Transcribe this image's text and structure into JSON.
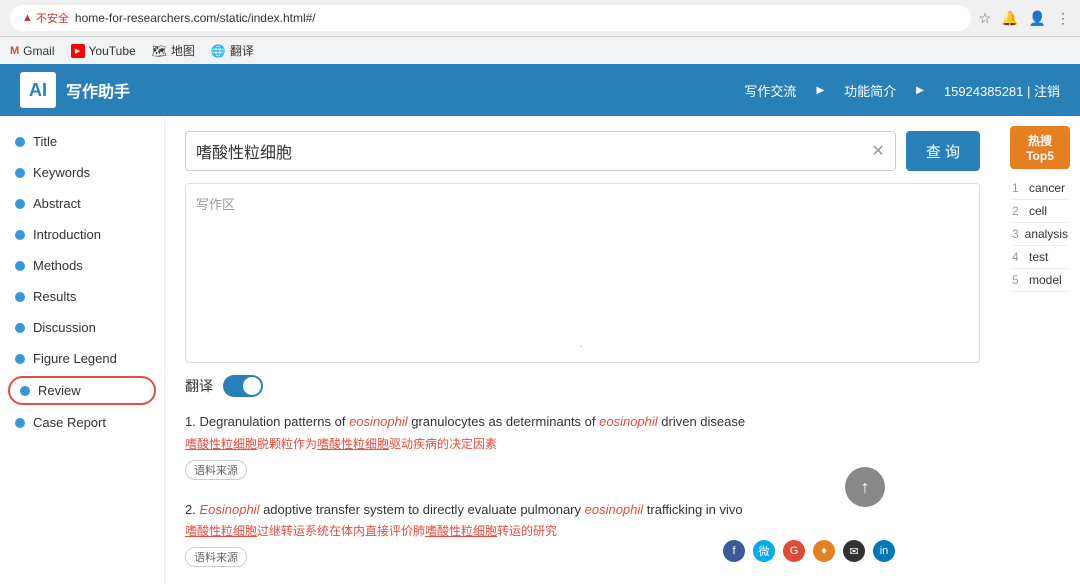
{
  "browser": {
    "warning_text": "不安全",
    "url": "home-for-researchers.com/static/index.html#/",
    "bookmarks": [
      {
        "label": "Gmail",
        "type": "gmail"
      },
      {
        "label": "YouTube",
        "type": "youtube"
      },
      {
        "label": "地图",
        "type": "maps"
      },
      {
        "label": "翻译",
        "type": "translate"
      }
    ]
  },
  "header": {
    "logo_text": "AI",
    "app_name": "写作助手",
    "nav_items": [
      "写作交流",
      "功能简介",
      "15924385281 | 注销"
    ]
  },
  "sidebar": {
    "items": [
      {
        "label": "Title"
      },
      {
        "label": "Keywords"
      },
      {
        "label": "Abstract"
      },
      {
        "label": "Introduction"
      },
      {
        "label": "Methods"
      },
      {
        "label": "Results"
      },
      {
        "label": "Discussion"
      },
      {
        "label": "Figure Legend"
      },
      {
        "label": "Review"
      },
      {
        "label": "Case Report"
      }
    ]
  },
  "main": {
    "search_value": "嗜酸性粒细胞",
    "search_placeholder": "",
    "search_btn_label": "查 询",
    "writing_placeholder": "写作区",
    "translate_label": "翻译",
    "results": [
      {
        "number": "1.",
        "title_before": "Degranulation patterns of ",
        "title_italic1": "eosinophil",
        "title_middle": " granulocytes as determinants of ",
        "title_italic2": "eosinophil",
        "title_after": " driven disease",
        "translation": "嗜酸性粒细胞脱颗粒作为嗜酸性粒细胞驱动疾病的决定因素",
        "translation_link1": "嗜酸性粒细胞",
        "translation_link2": "嗜酸性粒细胞",
        "source_label": "语料来源"
      },
      {
        "number": "2.",
        "title_before": "",
        "title_italic1": "Eosinophil",
        "title_middle": " adoptive transfer system to directly evaluate pulmonary ",
        "title_italic2": "eosinophil",
        "title_after": " trafficking in vivo",
        "translation": "嗜酸性粒细胞过继转运系统在体内直接评价肺嗜酸性粒细胞转运的研究",
        "translation_link1": "嗜酸性粒细胞",
        "translation_link2": "嗜酸性粒细胞",
        "source_label": "语料来源"
      }
    ]
  },
  "right_panel": {
    "title": "热搜 Top5",
    "items": [
      {
        "rank": "1",
        "word": "cancer"
      },
      {
        "rank": "2",
        "word": "cell"
      },
      {
        "rank": "3",
        "word": "analysis"
      },
      {
        "rank": "4",
        "word": "test"
      },
      {
        "rank": "5",
        "word": "model"
      }
    ]
  }
}
